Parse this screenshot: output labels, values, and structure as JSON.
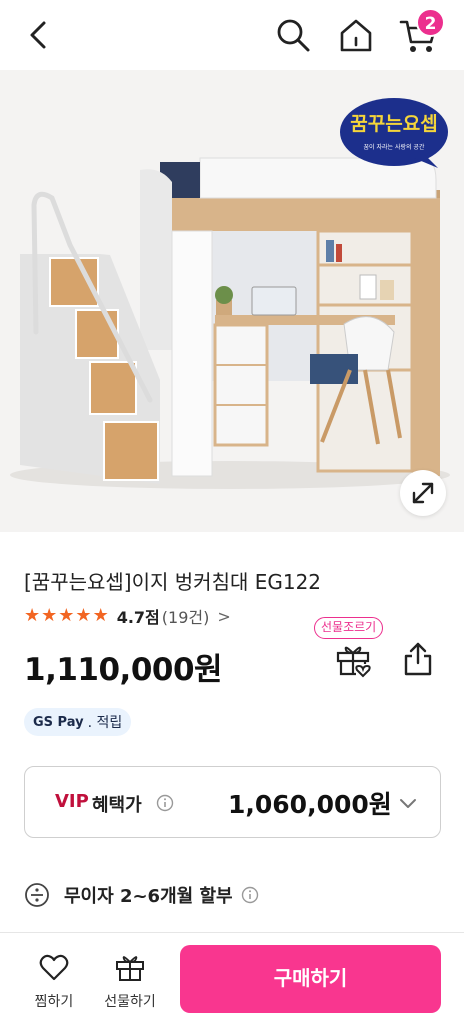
{
  "header": {
    "cart_count": "2"
  },
  "hero": {
    "brand_badge_text": "꿈꾸는요셉",
    "brand_badge_sub": "꿈이 자라는 사랑의 공간"
  },
  "product": {
    "title": "[꿈꾸는요셉]이지 벙커침대 EG122",
    "rating_stars": 4.7,
    "rating_score": "4.7점",
    "rating_count": "(19건)",
    "price": "1,110,000원",
    "gift_tag": "선물조르기"
  },
  "gspay": {
    "brand": "GS Pay",
    "suffix": ". 적립"
  },
  "vip": {
    "label": "VIP",
    "sub_label": "혜택가",
    "price": "1,060,000원"
  },
  "installment": {
    "text": "무이자 2~6개월 할부"
  },
  "bottom_bar": {
    "wish_label": "찜하기",
    "gift_label": "선물하기",
    "buy_label": "구매하기"
  },
  "colors": {
    "accent_pink": "#f9368f",
    "star_orange": "#f26522",
    "vip_red": "#c0103c"
  }
}
